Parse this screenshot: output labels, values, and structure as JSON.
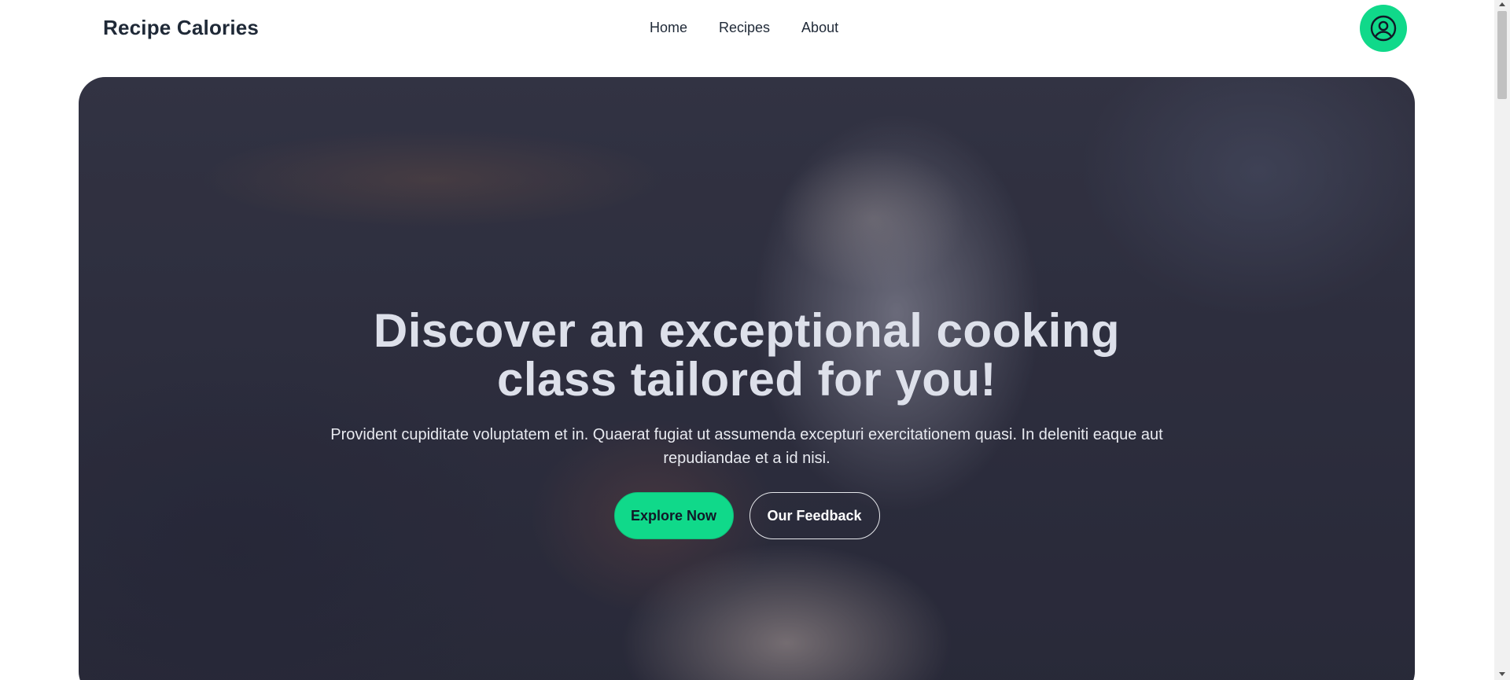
{
  "navbar": {
    "brand": "Recipe Calories",
    "links": [
      {
        "label": "Home"
      },
      {
        "label": "Recipes"
      },
      {
        "label": "About"
      }
    ],
    "account_icon": "user-circle-icon",
    "accent_color": "#10d98a"
  },
  "hero": {
    "title_line1": "Discover an exceptional cooking",
    "title_line2": "class tailored for you!",
    "text": "Provident cupiditate voluptatem et in. Quaerat fugiat ut assumenda excepturi exercitationem quasi. In deleniti eaque aut repudiandae et a id nisi.",
    "primary_button": "Explore Now",
    "secondary_button": "Our Feedback"
  }
}
